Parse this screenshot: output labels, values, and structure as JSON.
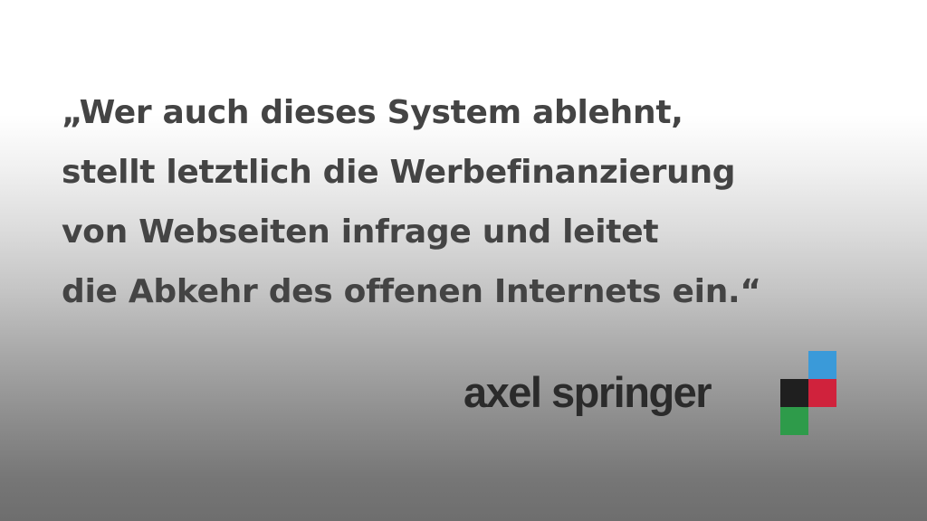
{
  "quote": {
    "lines": [
      "„Wer auch dieses System ablehnt,",
      "stellt letztlich die Werbefinanzierung",
      "von Webseiten infrage und leitet",
      "die Abkehr des offenen Internets ein.“"
    ]
  },
  "logo": {
    "wordmark": "axel springer",
    "colors": {
      "blue": "#3a9ad9",
      "black": "#1f1f1f",
      "red": "#d0223c",
      "green": "#2e9b4a",
      "text": "#2b2b2b"
    }
  }
}
